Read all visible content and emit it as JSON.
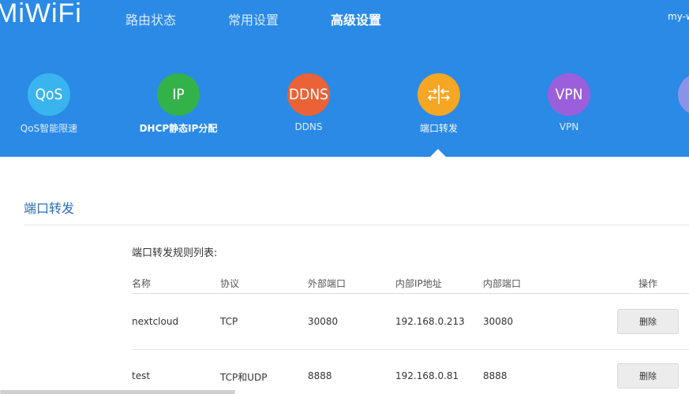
{
  "header": {
    "logo": "MiWiFi",
    "nav": [
      "路由状态",
      "常用设置",
      "高级设置"
    ],
    "user": "my-wifi"
  },
  "tools": [
    {
      "icon_text": "QoS",
      "label": "QoS智能限速",
      "color": "#3ab4ee"
    },
    {
      "icon_text": "IP",
      "label": "DHCP静态IP分配",
      "color": "#34b24a"
    },
    {
      "icon_text": "DDNS",
      "label": "DDNS",
      "color": "#ea6235"
    },
    {
      "icon_text": "",
      "label": "端口转发",
      "color": "#f5a623"
    },
    {
      "icon_text": "VPN",
      "label": "VPN",
      "color": "#9c5fdc"
    },
    {
      "icon_text": "",
      "label": "",
      "color": "#8a93e8"
    }
  ],
  "section": {
    "title": "端口转发",
    "list_title": "端口转发规则列表:"
  },
  "table": {
    "headers": [
      "名称",
      "协议",
      "外部端口",
      "内部IP地址",
      "内部端口",
      "操作"
    ],
    "rows": [
      {
        "name": "nextcloud",
        "protocol": "TCP",
        "ext_port": "30080",
        "int_ip": "192.168.0.213",
        "int_port": "30080",
        "action": "删除"
      },
      {
        "name": "test",
        "protocol": "TCP和UDP",
        "ext_port": "8888",
        "int_ip": "192.168.0.81",
        "int_port": "8888",
        "action": "删除"
      }
    ]
  }
}
